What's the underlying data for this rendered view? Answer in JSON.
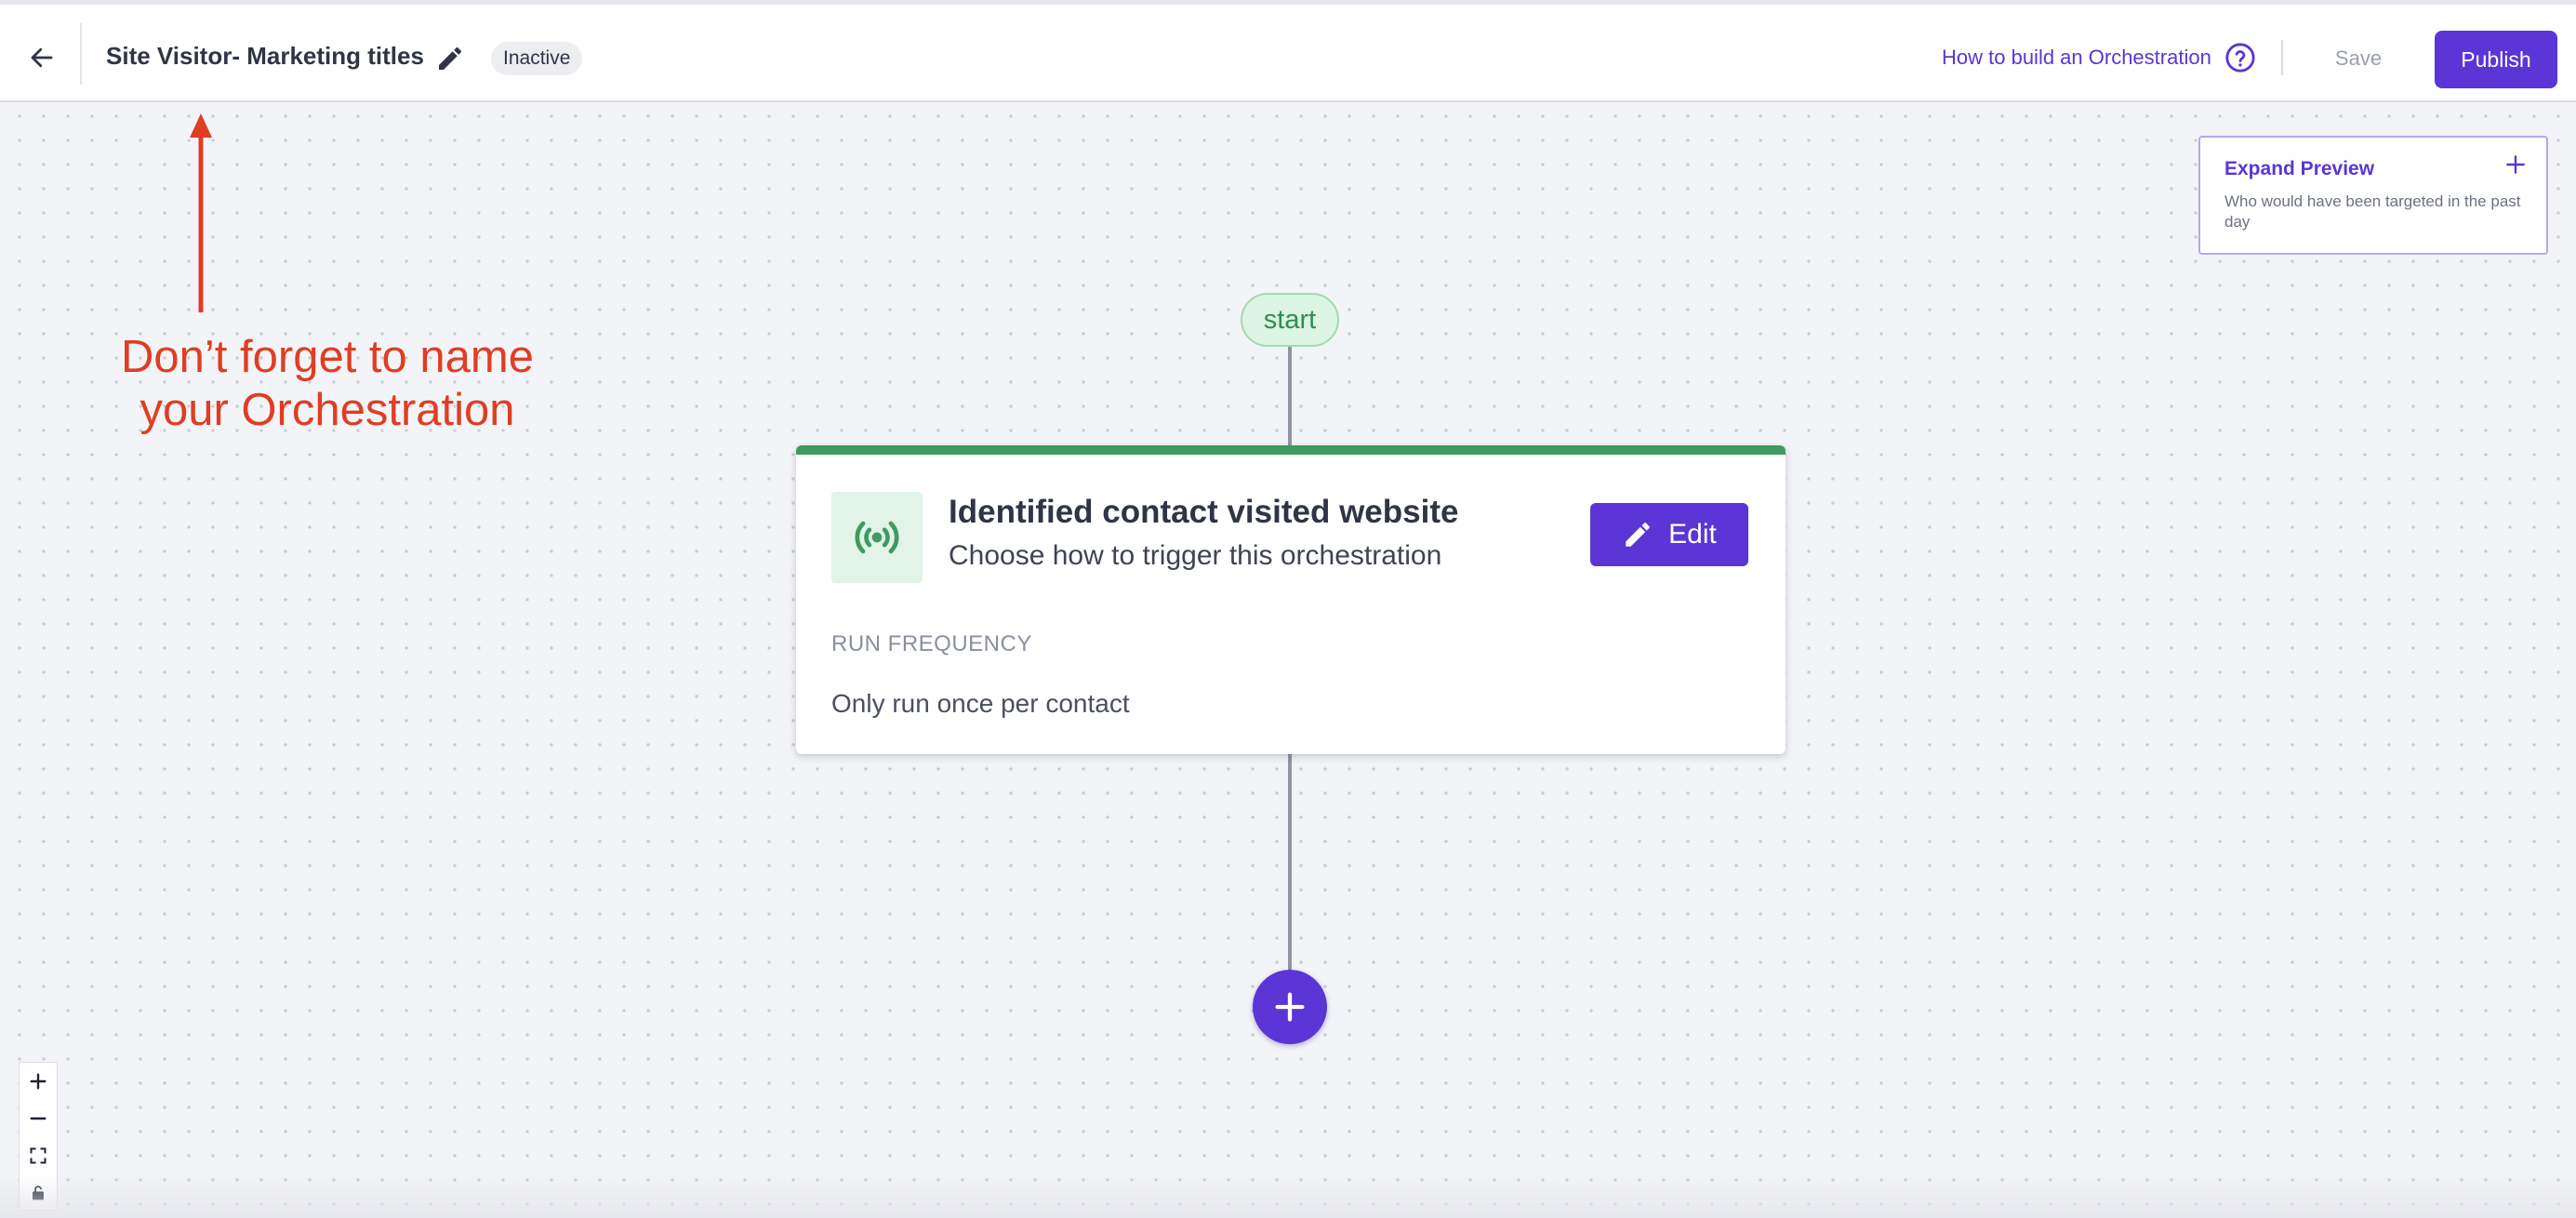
{
  "header": {
    "title": "Site Visitor- Marketing titles",
    "status": "Inactive",
    "help_link": "How to build an Orchestration",
    "save_label": "Save",
    "publish_label": "Publish"
  },
  "preview": {
    "title": "Expand Preview",
    "subtitle": "Who would have been targeted in the past day"
  },
  "annotation": {
    "line1": "Don’t forget to name",
    "line2": "your Orchestration",
    "color": "#e03d22"
  },
  "flow": {
    "start_label": "start",
    "trigger": {
      "title": "Identified contact visited website",
      "subtitle": "Choose how to trigger this orchestration",
      "edit_label": "Edit",
      "frequency_label": "RUN FREQUENCY",
      "frequency_value": "Only run once per contact",
      "icon": "broadcast-icon"
    }
  },
  "icons": {
    "back": "arrow-left-icon",
    "edit_title": "pencil-icon",
    "help": "question-circle-icon",
    "preview_expand": "plus-icon",
    "add_step": "plus-icon",
    "zoom_in": "plus-icon",
    "zoom_out": "minus-icon",
    "fit_view": "fit-view-icon",
    "lock": "lock-icon"
  },
  "colors": {
    "brand": "#5b35d5",
    "trigger_accent": "#3f9a5f",
    "start_green": "#2f8c52"
  }
}
